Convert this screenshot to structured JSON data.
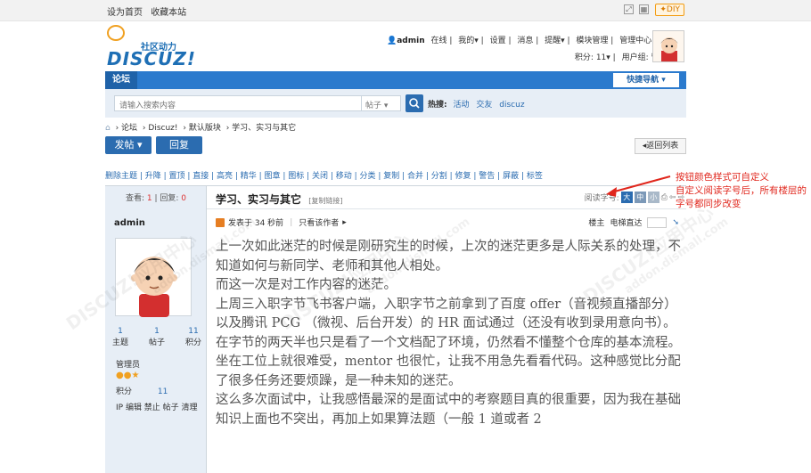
{
  "topbar": {
    "links": [
      "设为首页",
      "收藏本站"
    ],
    "diy": "✦DIY"
  },
  "header": {
    "slogan": "社区动力",
    "brand": "DISCUZ!",
    "user": "admin",
    "online": "在线",
    "nav": [
      "我的",
      "设置",
      "消息",
      "提醒",
      "模块管理",
      "管理中心",
      "退出"
    ],
    "points": "积分: 11",
    "usergroup": "用户组: 管理员"
  },
  "navbar": {
    "tab": "论坛",
    "quicknav": "快捷导航"
  },
  "search": {
    "placeholder": "请输入搜索内容",
    "type": "帖子",
    "hot_label": "热搜:",
    "hot": [
      "活动",
      "交友",
      "discuz"
    ]
  },
  "breadcrumb": [
    "论坛",
    "Discuz!",
    "默认版块",
    "学习、实习与其它"
  ],
  "actions": {
    "post": "发帖",
    "reply": "回复",
    "back": "◂返回列表"
  },
  "colors": {
    "primary": "#2b6cb0",
    "nav": "#2b7acd",
    "sidebar": "#e7eef6",
    "annotation": "#e0261c"
  },
  "main": {
    "moderation_bar": "删除主题 | 升降 | 置顶 | 直接 | 高亮 | 精华 | 图章 | 图标 | 关闭 | 移动 | 分类 | 复制 | 合并 | 分割 | 修复 | 警告 | 屏蔽 | 标签",
    "views_label": "查看:",
    "views": "1",
    "replies_label": "回复:",
    "replies": "0",
    "thread_title": "学习、实习与其它",
    "copy_link": "[复制链接]",
    "font_label": "阅读字号:",
    "font_sizes": [
      "大",
      "中",
      "小"
    ],
    "post_meta": {
      "posted": "发表于 34 秒前",
      "only_author": "只看该作者",
      "floor": "楼主",
      "go_to": "电梯直达"
    },
    "author": {
      "name": "admin",
      "stats": [
        {
          "value": "1",
          "label": "主题"
        },
        {
          "value": "1",
          "label": "帖子"
        },
        {
          "value": "11",
          "label": "积分"
        }
      ],
      "group": "管理员",
      "credits_label": "积分",
      "credits": "11",
      "actions": "IP 编辑 禁止 帖子 清理"
    },
    "post_body": [
      "上一次如此迷茫的时候是刚研究生的时候，上次的迷茫更多是人际关系的处理，不知道如何与新同学、老师和其他人相处。",
      "而这一次是对工作内容的迷茫。",
      "上周三入职字节飞书客户端，入职字节之前拿到了百度 offer（音视频直播部分） 以及腾讯 PCG （微视、后台开发）的 HR 面试通过（还没有收到录用意向书）。",
      "在字节的两天半也只是看了一个文档配了环境，仍然看不懂整个仓库的基本流程。坐在工位上就很难受，mentor 也很忙，让我不用急先看看代码。这种感觉比分配了很多任务还要烦躁，是一种未知的迷茫。",
      "这么多次面试中，让我感悟最深的是面试中的考察题目真的很重要，因为我在基础知识上面也不突出，再加上如果算法题（一般 1 道或者 2"
    ]
  },
  "annotation": "按钮颜色样式可自定义\n自定义阅读字号后，所有楼层的字号都同步改变",
  "watermarks": [
    "DISCUZ!应用中心",
    "addon.dismall.com"
  ]
}
